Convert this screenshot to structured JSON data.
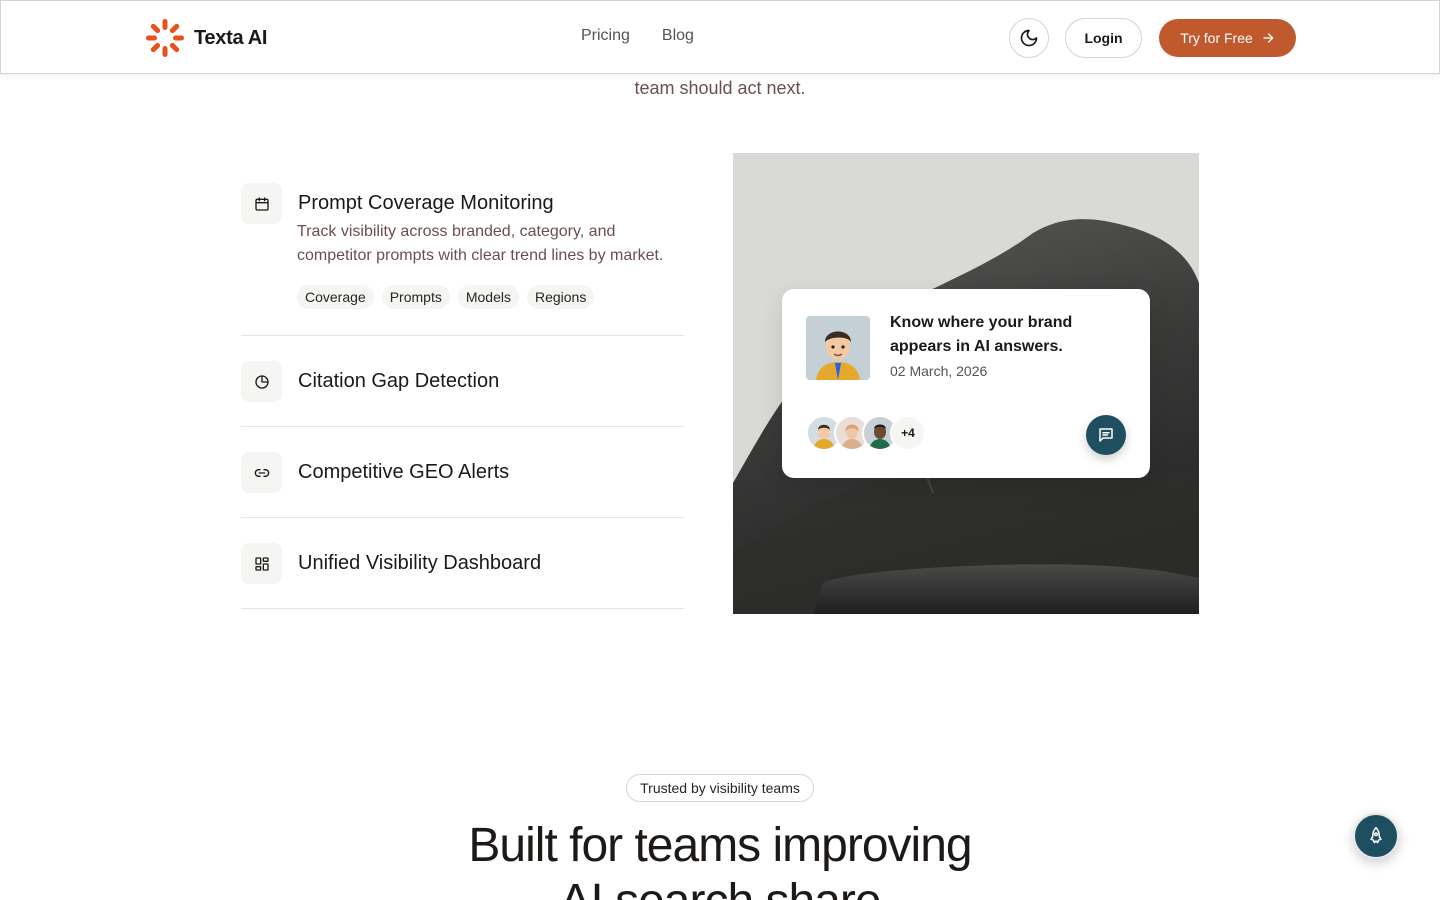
{
  "header": {
    "brand": "Texta AI",
    "nav": [
      "Pricing",
      "Blog"
    ],
    "login_label": "Login",
    "cta_label": "Try for Free",
    "accent_color": "#c05a2e"
  },
  "intro": {
    "partial_text": "team should act next."
  },
  "features": [
    {
      "title": "Prompt Coverage Monitoring",
      "icon": "calendar-icon",
      "description": "Track visibility across branded, category, and competitor prompts with clear trend lines by market.",
      "tags": [
        "Coverage",
        "Prompts",
        "Models",
        "Regions"
      ],
      "expanded": true
    },
    {
      "title": "Citation Gap Detection",
      "icon": "pie-chart-icon",
      "expanded": false
    },
    {
      "title": "Competitive GEO Alerts",
      "icon": "link-icon",
      "expanded": false
    },
    {
      "title": "Unified Visibility Dashboard",
      "icon": "dashboard-icon",
      "expanded": false
    }
  ],
  "card": {
    "title": "Know where your brand appears in AI answers.",
    "date": "02 March, 2026",
    "more_count": "+4"
  },
  "trusted": {
    "badge": "Trusted by visibility teams",
    "heading_line1": "Built for teams improving",
    "heading_line2": "AI search share"
  }
}
